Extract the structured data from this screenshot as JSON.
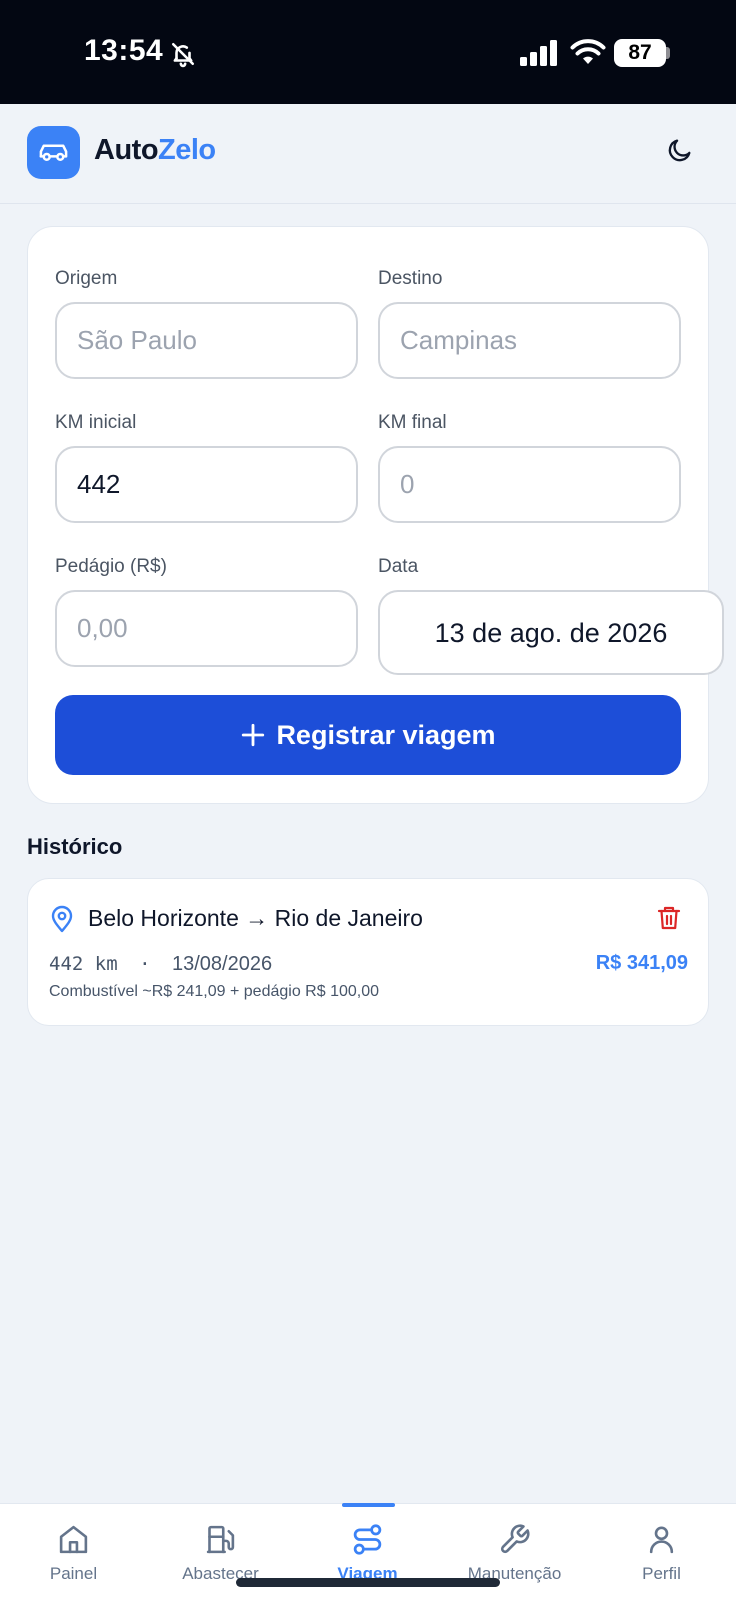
{
  "status_bar": {
    "time": "13:54",
    "battery": "87"
  },
  "header": {
    "title_part1": "Auto",
    "title_part2": "Zelo",
    "theme_toggle_icon": "moon-icon"
  },
  "form": {
    "origin": {
      "label": "Origem",
      "placeholder": "São Paulo",
      "value": ""
    },
    "destination": {
      "label": "Destino",
      "placeholder": "Campinas",
      "value": ""
    },
    "km_start": {
      "label": "KM inicial",
      "placeholder": "",
      "value": "442"
    },
    "km_end": {
      "label": "KM final",
      "placeholder": "0",
      "value": ""
    },
    "toll": {
      "label": "Pedágio (R$)",
      "placeholder": "0,00",
      "value": ""
    },
    "date": {
      "label": "Data",
      "value": "13 de ago. de 2026"
    },
    "submit_label": "Registrar viagem"
  },
  "history": {
    "title": "Histórico",
    "trips": [
      {
        "route": "Belo Horizonte → Rio de Janeiro",
        "distance": "442 km",
        "separator": "·",
        "date": "13/08/2026",
        "total": "R$ 341,09",
        "breakdown": "Combustível ~R$ 241,09 + pedágio R$ 100,00"
      }
    ]
  },
  "nav": {
    "items": [
      {
        "label": "Painel",
        "icon": "home-icon"
      },
      {
        "label": "Abastecer",
        "icon": "fuel-icon"
      },
      {
        "label": "Viagem",
        "icon": "route-icon",
        "active": true
      },
      {
        "label": "Manutenção",
        "icon": "wrench-icon"
      },
      {
        "label": "Perfil",
        "icon": "user-icon"
      }
    ]
  },
  "colors": {
    "accent": "#3b82f6",
    "primary_button": "#1d4ed8",
    "danger": "#dc2626",
    "background": "#eff3f8",
    "status_bar": "#030712"
  }
}
